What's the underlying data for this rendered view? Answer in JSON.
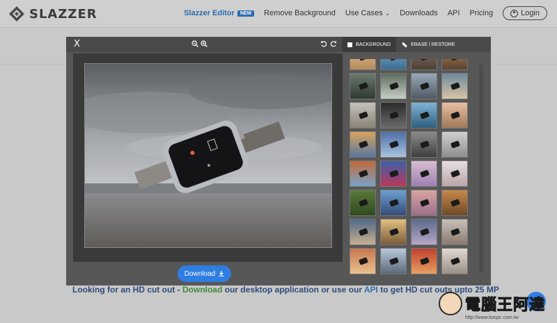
{
  "brand": {
    "name": "SLAZZER"
  },
  "nav": {
    "editor": "Slazzer Editor",
    "new_badge": "NEW",
    "remove_bg": "Remove Background",
    "use_cases": "Use Cases",
    "use_cases_chevron": "⌄",
    "downloads": "Downloads",
    "api": "API",
    "pricing": "Pricing",
    "login": "Login"
  },
  "editor": {
    "close": "X",
    "tabs": [
      "BACKGROUND",
      "ERASE / RESTORE"
    ],
    "download": "Download"
  },
  "cta": {
    "part1": "Looking for an HD cut out - ",
    "download_link": "Download",
    "part2": " our desktop application or use our ",
    "api_link": "API",
    "part3": " to get HD cut outs upto 25 MP"
  },
  "watermark": {
    "text": "電腦王阿達",
    "url": "http://www.kocpc.com.tw"
  },
  "colors": {
    "accent": "#2c6db0",
    "download": "#2f7de1",
    "modal": "#575757"
  }
}
